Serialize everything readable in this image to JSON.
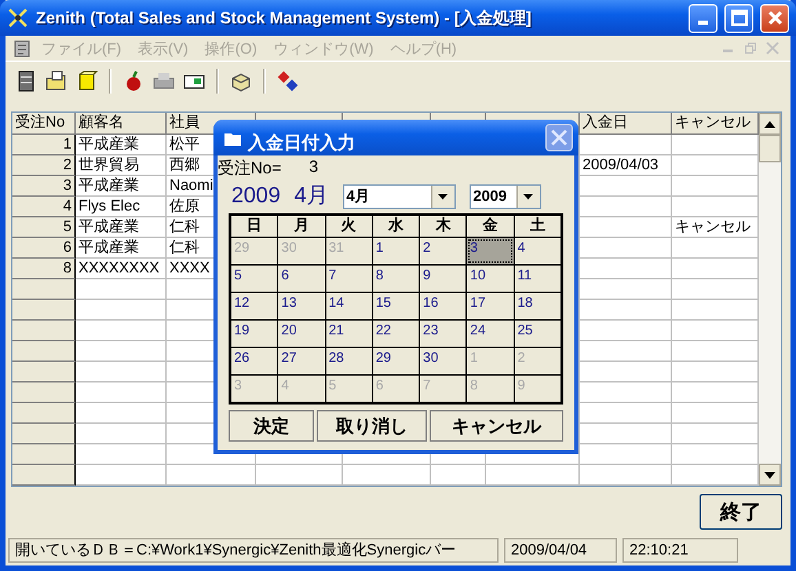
{
  "window": {
    "title": "Zenith (Total Sales and Stock Management System) - [入金処理]"
  },
  "menu": [
    {
      "label": "ファイル(F)",
      "disabled": true
    },
    {
      "label": "表示(V)",
      "disabled": true
    },
    {
      "label": "操作(O)",
      "disabled": true
    },
    {
      "label": "ウィンドウ(W)",
      "disabled": true
    },
    {
      "label": "ヘルプ(H)",
      "disabled": true
    }
  ],
  "table": {
    "columns": [
      {
        "label": "受注No"
      },
      {
        "label": "顧客名"
      },
      {
        "label": "社員"
      },
      {
        "label": "入金日"
      },
      {
        "label": "キャンセル"
      }
    ],
    "rows": [
      {
        "no": "1",
        "customer": "平成産業",
        "employee": "松平"
      },
      {
        "no": "2",
        "customer": "世界貿易",
        "employee": "西郷",
        "payment_date": "2009/04/03"
      },
      {
        "no": "3",
        "customer": "平成産業",
        "employee": "Naomi"
      },
      {
        "no": "4",
        "customer": "Flys Elec",
        "employee": "佐原"
      },
      {
        "no": "5",
        "customer": "平成産業",
        "employee": "仁科",
        "cancel": "キャンセル"
      },
      {
        "no": "6",
        "customer": "平成産業",
        "employee": "仁科"
      },
      {
        "no": "8",
        "customer": "XXXXXXXX",
        "employee": "XXXX"
      }
    ]
  },
  "dialog": {
    "title": "入金日付入力",
    "order_label": "受注No=",
    "order_value": "3",
    "year": "2009",
    "month": "4月",
    "month_select": "4月",
    "year_select": "2009",
    "weekdays": [
      "日",
      "月",
      "火",
      "水",
      "木",
      "金",
      "土"
    ],
    "days": [
      {
        "day": "29",
        "kind": "other",
        "selected": false
      },
      {
        "day": "30",
        "kind": "other",
        "selected": false
      },
      {
        "day": "31",
        "kind": "other",
        "selected": false
      },
      {
        "day": "1",
        "kind": "current",
        "selected": false
      },
      {
        "day": "2",
        "kind": "current",
        "selected": false
      },
      {
        "day": "3",
        "kind": "current",
        "selected": true
      },
      {
        "day": "4",
        "kind": "current",
        "selected": false
      },
      {
        "day": "5",
        "kind": "current",
        "selected": false
      },
      {
        "day": "6",
        "kind": "current",
        "selected": false
      },
      {
        "day": "7",
        "kind": "current",
        "selected": false
      },
      {
        "day": "8",
        "kind": "current",
        "selected": false
      },
      {
        "day": "9",
        "kind": "current",
        "selected": false
      },
      {
        "day": "10",
        "kind": "current",
        "selected": false
      },
      {
        "day": "11",
        "kind": "current",
        "selected": false
      },
      {
        "day": "12",
        "kind": "current",
        "selected": false
      },
      {
        "day": "13",
        "kind": "current",
        "selected": false
      },
      {
        "day": "14",
        "kind": "current",
        "selected": false
      },
      {
        "day": "15",
        "kind": "current",
        "selected": false
      },
      {
        "day": "16",
        "kind": "current",
        "selected": false
      },
      {
        "day": "17",
        "kind": "current",
        "selected": false
      },
      {
        "day": "18",
        "kind": "current",
        "selected": false
      },
      {
        "day": "19",
        "kind": "current",
        "selected": false
      },
      {
        "day": "20",
        "kind": "current",
        "selected": false
      },
      {
        "day": "21",
        "kind": "current",
        "selected": false
      },
      {
        "day": "22",
        "kind": "current",
        "selected": false
      },
      {
        "day": "23",
        "kind": "current",
        "selected": false
      },
      {
        "day": "24",
        "kind": "current",
        "selected": false
      },
      {
        "day": "25",
        "kind": "current",
        "selected": false
      },
      {
        "day": "26",
        "kind": "current",
        "selected": false
      },
      {
        "day": "27",
        "kind": "current",
        "selected": false
      },
      {
        "day": "28",
        "kind": "current",
        "selected": false
      },
      {
        "day": "29",
        "kind": "current",
        "selected": false
      },
      {
        "day": "30",
        "kind": "current",
        "selected": false
      },
      {
        "day": "1",
        "kind": "other",
        "selected": false
      },
      {
        "day": "2",
        "kind": "other",
        "selected": false
      },
      {
        "day": "3",
        "kind": "other",
        "selected": false
      },
      {
        "day": "4",
        "kind": "other",
        "selected": false
      },
      {
        "day": "5",
        "kind": "other",
        "selected": false
      },
      {
        "day": "6",
        "kind": "other",
        "selected": false
      },
      {
        "day": "7",
        "kind": "other",
        "selected": false
      },
      {
        "day": "8",
        "kind": "other",
        "selected": false
      },
      {
        "day": "9",
        "kind": "other",
        "selected": false
      }
    ],
    "buttons": [
      "決定",
      "取り消し",
      "キャンセル"
    ]
  },
  "exit_button": "終了",
  "status_bar": [
    "開いているＤＢ＝C:¥Work1¥Synergic¥Zenith最適化Synergicバー",
    "2009/04/04",
    "22:10:21"
  ]
}
